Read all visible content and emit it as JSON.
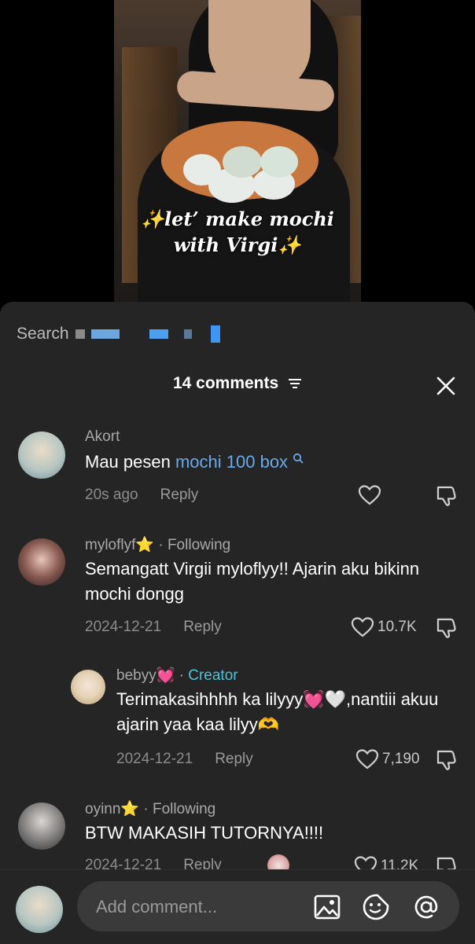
{
  "video": {
    "caption_line1": "✨let’ make mochi",
    "caption_line2": "with Virgi✨"
  },
  "search": {
    "label": "Search"
  },
  "header": {
    "title": "14 comments"
  },
  "comments": [
    {
      "author": "Akort",
      "text_prefix": "Mau pesen ",
      "text_link": "mochi 100 box",
      "time": "20s ago",
      "reply": "Reply"
    },
    {
      "author": "myloflyf⭐",
      "following": " · Following",
      "text": "Semangatt Virgii myloflyy!! Ajarin aku bikinn mochi dongg",
      "time": "2024-12-21",
      "reply": "Reply",
      "likes": "10.7K"
    },
    {
      "author": "bebyy💓",
      "role": "Creator",
      "text": "Terimakasihhhh ka lilyyy💓🤍,nantiii akuu ajarin yaa kaa lilyy🫶",
      "time": "2024-12-21",
      "reply": "Reply",
      "likes": "7,190"
    },
    {
      "author": "oyinn⭐",
      "following": " · Following",
      "text": "BTW MAKASIH TUTORNYA!!!!",
      "time": "2024-12-21",
      "reply": "Reply",
      "likes": "11.2K"
    }
  ],
  "composer": {
    "placeholder": "Add comment..."
  },
  "icons": [
    "filter-icon",
    "close-icon",
    "search-suggest-icon",
    "heart-icon",
    "dislike-icon",
    "image-icon",
    "sticker-icon",
    "mention-icon"
  ],
  "colors": {
    "sheet_bg": "#252525",
    "link": "#6aa9ea",
    "creator": "#4ec3d8"
  }
}
